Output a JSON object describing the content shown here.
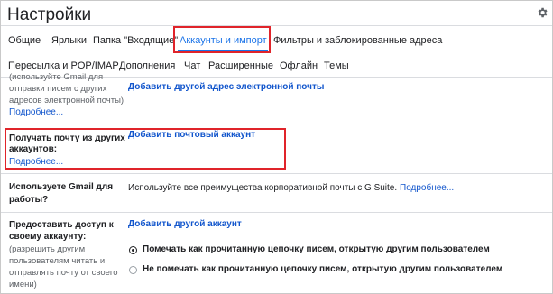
{
  "header": {
    "title": "Настройки",
    "settings_icon": "gear-icon"
  },
  "tabs_row1": [
    {
      "label": "Общие"
    },
    {
      "label": "Ярлыки"
    },
    {
      "label": "Папка \"Входящие\""
    },
    {
      "label": "Аккаунты и импорт",
      "active": true
    },
    {
      "label": "Фильтры и заблокированные адреса"
    }
  ],
  "tabs_row2": [
    {
      "label": "Пересылка и POP/IMAP"
    },
    {
      "label": "Дополнения"
    },
    {
      "label": "Чат"
    },
    {
      "label": "Расширенные"
    },
    {
      "label": "Офлайн"
    },
    {
      "label": "Темы"
    }
  ],
  "sections": {
    "send_mail": {
      "desc_line1": "(используйте Gmail для",
      "desc_line2": "отправки писем с других",
      "desc_line3": "адресов электронной почты)",
      "more_link": "Подробнее...",
      "action_link": "Добавить другой адрес электронной почты"
    },
    "check_mail": {
      "label_line1": "Получать почту из других",
      "label_line2": "аккаунтов:",
      "more_link": "Подробнее...",
      "action_link": "Добавить почтовый аккаунт"
    },
    "gsuite": {
      "label_line1": "Используете Gmail для",
      "label_line2": "работы?",
      "text": "Используйте все преимущества корпоративной почты с G Suite.",
      "more_link": "Подробнее..."
    },
    "grant_access": {
      "label_line1": "Предоставить доступ к",
      "label_line2": "своему аккаунту:",
      "desc_line1": "(разрешить другим",
      "desc_line2": "пользователям читать и",
      "desc_line3": "отправлять почту от своего",
      "desc_line4": "имени)",
      "action_link": "Добавить другой аккаунт",
      "option1": "Помечать как прочитанную цепочку писем, открытую другим пользователем",
      "option2": "Не помечать как прочитанную цепочку писем, открытую другим пользователем",
      "selected": "option1"
    }
  },
  "colors": {
    "accent": "#1a73e8",
    "link": "#1155cc",
    "highlight": "#e0242a"
  }
}
